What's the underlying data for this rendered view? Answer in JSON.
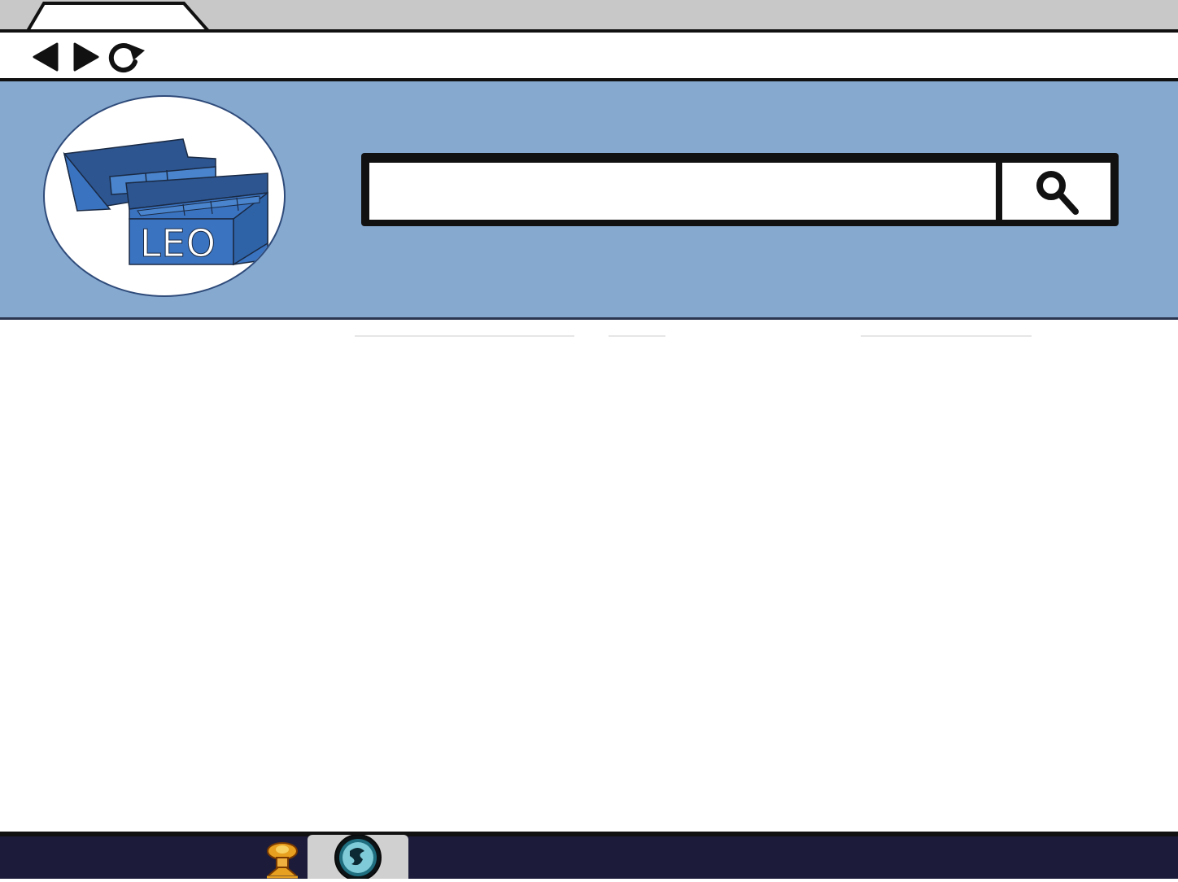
{
  "browser": {
    "tab": {
      "title": ""
    },
    "nav": {
      "back_icon": "back-arrow-icon",
      "forward_icon": "forward-arrow-icon",
      "reload_icon": "reload-icon"
    }
  },
  "header": {
    "logo": {
      "text": "LEO",
      "icon": "storage-box-logo"
    },
    "search": {
      "value": "",
      "placeholder": "",
      "button_icon": "magnifier-icon"
    }
  },
  "taskbar": {
    "apps": [
      {
        "icon": "app-mascot-icon",
        "active": false
      },
      {
        "icon": "app-circle-icon",
        "active": true
      }
    ]
  },
  "colors": {
    "header_bg": "#86a9cf",
    "tab_strip_bg": "#c8c8c8",
    "taskbar_bg": "#1c1c3a",
    "logo_blue": "#3a73c0",
    "logo_dark_blue": "#2c5690"
  }
}
